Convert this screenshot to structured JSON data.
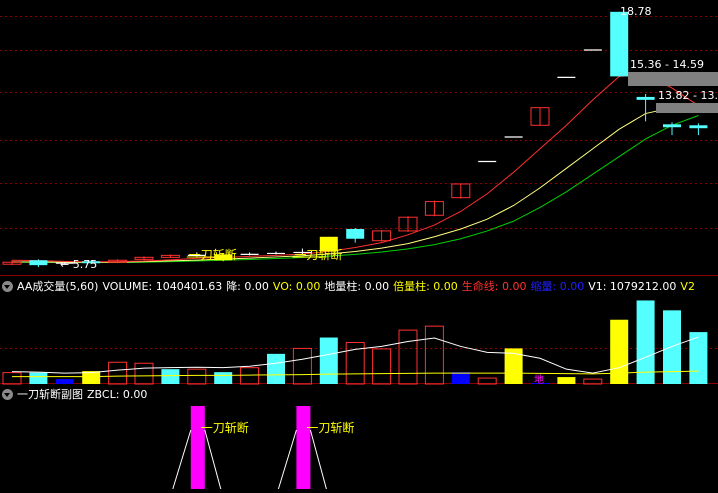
{
  "main_chart": {
    "price_labels": {
      "high": "18.78",
      "low_arrow": "← 5.75",
      "box1": "15.36 - 14.59",
      "box2": "13.82 - 13."
    },
    "signal_label": "一刀斩断"
  },
  "volume_panel": {
    "title": "AA成交量(5,60)",
    "items": [
      {
        "label": "VOLUME:",
        "value": "1040401.63",
        "color": "#ffffff"
      },
      {
        "label": "降:",
        "value": "0.00",
        "color": "#ffffff"
      },
      {
        "label": "VO:",
        "value": "0.00",
        "color": "#ffff00"
      },
      {
        "label": "地量柱:",
        "value": "0.00",
        "color": "#ffffff"
      },
      {
        "label": "倍量柱:",
        "value": "0.00",
        "color": "#ffff00"
      },
      {
        "label": "生命线:",
        "value": "0.00",
        "color": "#ff3030"
      },
      {
        "label": "缩量:",
        "value": "0.00",
        "color": "#2020ff"
      },
      {
        "label": "V1:",
        "value": "1079212.00",
        "color": "#ffffff"
      },
      {
        "label": "V2",
        "value": "",
        "color": "#ffff00"
      }
    ],
    "bottom_marker": "地"
  },
  "sub_panel": {
    "title": "一刀斩断副图",
    "items": [
      {
        "label": "ZBCL:",
        "value": "0.00",
        "color": "#ffffff"
      }
    ],
    "signal_label": "一刀斩断"
  },
  "colors": {
    "up": "#ff3030",
    "down": "#54ffff",
    "yellow": "#ffff00",
    "blue": "#0000ff",
    "magenta": "#ff00ff",
    "grid": "#8b0000",
    "gray": "#808080"
  },
  "chart_data": {
    "type": "candlestick",
    "candles": [
      {
        "o": 5.9,
        "c": 6.0,
        "h": 6.1,
        "l": 5.85,
        "kind": "up"
      },
      {
        "o": 6.1,
        "c": 5.85,
        "h": 6.15,
        "l": 5.75,
        "kind": "down"
      },
      {
        "o": 5.95,
        "c": 5.95,
        "h": 6.0,
        "l": 5.9,
        "kind": "flat"
      },
      {
        "o": 6.05,
        "c": 5.95,
        "h": 6.1,
        "l": 5.9,
        "kind": "down"
      },
      {
        "o": 6.0,
        "c": 6.1,
        "h": 6.15,
        "l": 5.95,
        "kind": "up"
      },
      {
        "o": 6.15,
        "c": 6.25,
        "h": 6.3,
        "l": 6.1,
        "kind": "up"
      },
      {
        "o": 6.3,
        "c": 6.35,
        "h": 6.4,
        "l": 6.25,
        "kind": "up"
      },
      {
        "o": 6.35,
        "c": 6.35,
        "h": 6.5,
        "l": 6.3,
        "kind": "flat"
      },
      {
        "o": 6.1,
        "c": 6.4,
        "h": 6.45,
        "l": 6.05,
        "kind": "yellow"
      },
      {
        "o": 6.4,
        "c": 6.4,
        "h": 6.5,
        "l": 6.35,
        "kind": "flat"
      },
      {
        "o": 6.45,
        "c": 6.45,
        "h": 6.55,
        "l": 6.4,
        "kind": "flat"
      },
      {
        "o": 6.5,
        "c": 6.5,
        "h": 6.7,
        "l": 6.4,
        "kind": "flat"
      },
      {
        "o": 6.55,
        "c": 7.3,
        "h": 7.3,
        "l": 6.5,
        "kind": "yellow"
      },
      {
        "o": 7.7,
        "c": 7.2,
        "h": 7.75,
        "l": 7.0,
        "kind": "down"
      },
      {
        "o": 7.1,
        "c": 7.6,
        "h": 7.65,
        "l": 7.05,
        "kind": "up"
      },
      {
        "o": 7.6,
        "c": 8.3,
        "h": 8.35,
        "l": 7.55,
        "kind": "up"
      },
      {
        "o": 8.4,
        "c": 9.1,
        "h": 9.15,
        "l": 8.35,
        "kind": "up"
      },
      {
        "o": 9.3,
        "c": 10.0,
        "h": 10.0,
        "l": 9.25,
        "kind": "up"
      },
      {
        "o": 11.15,
        "c": 11.15,
        "h": 11.15,
        "l": 11.15,
        "kind": "flat"
      },
      {
        "o": 12.4,
        "c": 12.4,
        "h": 12.4,
        "l": 12.4,
        "kind": "flat"
      },
      {
        "o": 13.0,
        "c": 13.9,
        "h": 13.9,
        "l": 13.0,
        "kind": "up"
      },
      {
        "o": 15.45,
        "c": 15.45,
        "h": 15.45,
        "l": 15.45,
        "kind": "flat"
      },
      {
        "o": 16.85,
        "c": 16.85,
        "h": 16.85,
        "l": 16.85,
        "kind": "flat"
      },
      {
        "o": 18.8,
        "c": 15.5,
        "h": 18.8,
        "l": 15.5,
        "kind": "down"
      },
      {
        "o": 14.45,
        "c": 14.3,
        "h": 14.6,
        "l": 13.2,
        "kind": "down"
      },
      {
        "o": 13.05,
        "c": 12.9,
        "h": 13.15,
        "l": 12.5,
        "kind": "down"
      },
      {
        "o": 13.0,
        "c": 12.85,
        "h": 13.1,
        "l": 12.5,
        "kind": "down"
      }
    ],
    "ma_red": [
      6.1,
      6.08,
      6.04,
      6.02,
      6.03,
      6.06,
      6.12,
      6.2,
      6.24,
      6.3,
      6.35,
      6.42,
      6.55,
      6.75,
      7.0,
      7.4,
      7.9,
      8.6,
      9.5,
      10.6,
      11.8,
      13.0,
      14.3,
      15.5,
      15.6,
      14.9,
      14.0
    ],
    "ma_yellow": [
      6.02,
      6.01,
      6.0,
      5.99,
      6.0,
      6.03,
      6.07,
      6.11,
      6.16,
      6.21,
      6.27,
      6.33,
      6.42,
      6.55,
      6.72,
      6.95,
      7.3,
      7.7,
      8.2,
      8.9,
      9.8,
      10.8,
      11.8,
      12.8,
      13.6,
      13.9,
      14.0
    ],
    "ma_green": [
      6.0,
      6.0,
      5.99,
      5.98,
      5.99,
      6.0,
      6.03,
      6.06,
      6.1,
      6.14,
      6.19,
      6.24,
      6.31,
      6.4,
      6.52,
      6.68,
      6.9,
      7.2,
      7.6,
      8.1,
      8.8,
      9.6,
      10.5,
      11.4,
      12.3,
      13.0,
      13.5
    ],
    "volume": [
      {
        "v": 230,
        "kind": "up"
      },
      {
        "v": 230,
        "kind": "down"
      },
      {
        "v": 100,
        "kind": "blue"
      },
      {
        "v": 260,
        "kind": "yellow"
      },
      {
        "v": 440,
        "kind": "up"
      },
      {
        "v": 420,
        "kind": "up"
      },
      {
        "v": 300,
        "kind": "down"
      },
      {
        "v": 300,
        "kind": "up"
      },
      {
        "v": 240,
        "kind": "down"
      },
      {
        "v": 330,
        "kind": "up"
      },
      {
        "v": 610,
        "kind": "down"
      },
      {
        "v": 720,
        "kind": "up"
      },
      {
        "v": 940,
        "kind": "down"
      },
      {
        "v": 840,
        "kind": "up"
      },
      {
        "v": 710,
        "kind": "up"
      },
      {
        "v": 1090,
        "kind": "up"
      },
      {
        "v": 1170,
        "kind": "up"
      },
      {
        "v": 240,
        "kind": "blue"
      },
      {
        "v": 120,
        "kind": "up"
      },
      {
        "v": 720,
        "kind": "yellow"
      },
      {
        "v": 20,
        "kind": "blue"
      },
      {
        "v": 140,
        "kind": "yellow"
      },
      {
        "v": 100,
        "kind": "up"
      },
      {
        "v": 1300,
        "kind": "yellow"
      },
      {
        "v": 1690,
        "kind": "down"
      },
      {
        "v": 1490,
        "kind": "down"
      },
      {
        "v": 1050,
        "kind": "down"
      }
    ],
    "vol_ma_white": [
      250,
      240,
      220,
      230,
      280,
      320,
      330,
      340,
      330,
      360,
      420,
      500,
      600,
      700,
      760,
      860,
      930,
      760,
      640,
      620,
      520,
      300,
      220,
      330,
      540,
      760,
      950
    ],
    "vol_ma_yellow": [
      150,
      150,
      150,
      150,
      160,
      165,
      170,
      175,
      175,
      180,
      185,
      190,
      200,
      205,
      210,
      215,
      220,
      220,
      220,
      220,
      215,
      210,
      205,
      220,
      240,
      250,
      260
    ],
    "signals": [
      7,
      11
    ],
    "price_range": [
      5.5,
      19.2
    ],
    "volume_range": [
      0,
      1780
    ]
  }
}
